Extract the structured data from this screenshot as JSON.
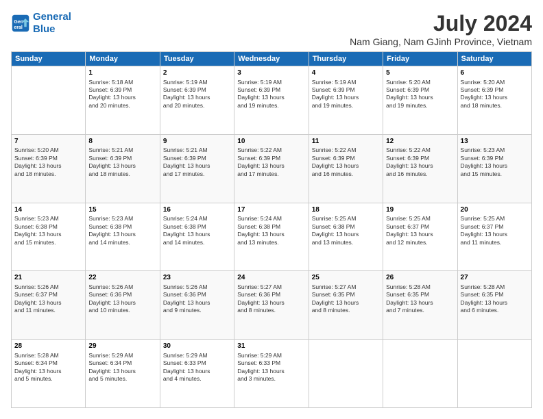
{
  "logo": {
    "line1": "General",
    "line2": "Blue"
  },
  "title": "July 2024",
  "subtitle": "Nam Giang, Nam GJinh Province, Vietnam",
  "weekdays": [
    "Sunday",
    "Monday",
    "Tuesday",
    "Wednesday",
    "Thursday",
    "Friday",
    "Saturday"
  ],
  "weeks": [
    [
      {
        "day": "",
        "info": ""
      },
      {
        "day": "1",
        "info": "Sunrise: 5:18 AM\nSunset: 6:39 PM\nDaylight: 13 hours\nand 20 minutes."
      },
      {
        "day": "2",
        "info": "Sunrise: 5:19 AM\nSunset: 6:39 PM\nDaylight: 13 hours\nand 20 minutes."
      },
      {
        "day": "3",
        "info": "Sunrise: 5:19 AM\nSunset: 6:39 PM\nDaylight: 13 hours\nand 19 minutes."
      },
      {
        "day": "4",
        "info": "Sunrise: 5:19 AM\nSunset: 6:39 PM\nDaylight: 13 hours\nand 19 minutes."
      },
      {
        "day": "5",
        "info": "Sunrise: 5:20 AM\nSunset: 6:39 PM\nDaylight: 13 hours\nand 19 minutes."
      },
      {
        "day": "6",
        "info": "Sunrise: 5:20 AM\nSunset: 6:39 PM\nDaylight: 13 hours\nand 18 minutes."
      }
    ],
    [
      {
        "day": "7",
        "info": "Sunrise: 5:20 AM\nSunset: 6:39 PM\nDaylight: 13 hours\nand 18 minutes."
      },
      {
        "day": "8",
        "info": "Sunrise: 5:21 AM\nSunset: 6:39 PM\nDaylight: 13 hours\nand 18 minutes."
      },
      {
        "day": "9",
        "info": "Sunrise: 5:21 AM\nSunset: 6:39 PM\nDaylight: 13 hours\nand 17 minutes."
      },
      {
        "day": "10",
        "info": "Sunrise: 5:22 AM\nSunset: 6:39 PM\nDaylight: 13 hours\nand 17 minutes."
      },
      {
        "day": "11",
        "info": "Sunrise: 5:22 AM\nSunset: 6:39 PM\nDaylight: 13 hours\nand 16 minutes."
      },
      {
        "day": "12",
        "info": "Sunrise: 5:22 AM\nSunset: 6:39 PM\nDaylight: 13 hours\nand 16 minutes."
      },
      {
        "day": "13",
        "info": "Sunrise: 5:23 AM\nSunset: 6:39 PM\nDaylight: 13 hours\nand 15 minutes."
      }
    ],
    [
      {
        "day": "14",
        "info": "Sunrise: 5:23 AM\nSunset: 6:38 PM\nDaylight: 13 hours\nand 15 minutes."
      },
      {
        "day": "15",
        "info": "Sunrise: 5:23 AM\nSunset: 6:38 PM\nDaylight: 13 hours\nand 14 minutes."
      },
      {
        "day": "16",
        "info": "Sunrise: 5:24 AM\nSunset: 6:38 PM\nDaylight: 13 hours\nand 14 minutes."
      },
      {
        "day": "17",
        "info": "Sunrise: 5:24 AM\nSunset: 6:38 PM\nDaylight: 13 hours\nand 13 minutes."
      },
      {
        "day": "18",
        "info": "Sunrise: 5:25 AM\nSunset: 6:38 PM\nDaylight: 13 hours\nand 13 minutes."
      },
      {
        "day": "19",
        "info": "Sunrise: 5:25 AM\nSunset: 6:37 PM\nDaylight: 13 hours\nand 12 minutes."
      },
      {
        "day": "20",
        "info": "Sunrise: 5:25 AM\nSunset: 6:37 PM\nDaylight: 13 hours\nand 11 minutes."
      }
    ],
    [
      {
        "day": "21",
        "info": "Sunrise: 5:26 AM\nSunset: 6:37 PM\nDaylight: 13 hours\nand 11 minutes."
      },
      {
        "day": "22",
        "info": "Sunrise: 5:26 AM\nSunset: 6:36 PM\nDaylight: 13 hours\nand 10 minutes."
      },
      {
        "day": "23",
        "info": "Sunrise: 5:26 AM\nSunset: 6:36 PM\nDaylight: 13 hours\nand 9 minutes."
      },
      {
        "day": "24",
        "info": "Sunrise: 5:27 AM\nSunset: 6:36 PM\nDaylight: 13 hours\nand 8 minutes."
      },
      {
        "day": "25",
        "info": "Sunrise: 5:27 AM\nSunset: 6:35 PM\nDaylight: 13 hours\nand 8 minutes."
      },
      {
        "day": "26",
        "info": "Sunrise: 5:28 AM\nSunset: 6:35 PM\nDaylight: 13 hours\nand 7 minutes."
      },
      {
        "day": "27",
        "info": "Sunrise: 5:28 AM\nSunset: 6:35 PM\nDaylight: 13 hours\nand 6 minutes."
      }
    ],
    [
      {
        "day": "28",
        "info": "Sunrise: 5:28 AM\nSunset: 6:34 PM\nDaylight: 13 hours\nand 5 minutes."
      },
      {
        "day": "29",
        "info": "Sunrise: 5:29 AM\nSunset: 6:34 PM\nDaylight: 13 hours\nand 5 minutes."
      },
      {
        "day": "30",
        "info": "Sunrise: 5:29 AM\nSunset: 6:33 PM\nDaylight: 13 hours\nand 4 minutes."
      },
      {
        "day": "31",
        "info": "Sunrise: 5:29 AM\nSunset: 6:33 PM\nDaylight: 13 hours\nand 3 minutes."
      },
      {
        "day": "",
        "info": ""
      },
      {
        "day": "",
        "info": ""
      },
      {
        "day": "",
        "info": ""
      }
    ]
  ]
}
